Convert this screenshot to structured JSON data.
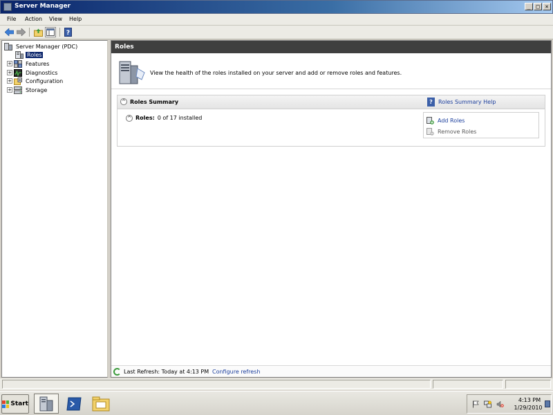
{
  "window": {
    "title": "Server Manager"
  },
  "menu": [
    "File",
    "Action",
    "View",
    "Help"
  ],
  "toolbar": {
    "icons": [
      "back-arrow-icon",
      "forward-arrow-icon",
      "up-folder-icon",
      "show-hide-tree-icon",
      "help-icon"
    ]
  },
  "tree": {
    "root": "Server Manager (PDC)",
    "items": [
      {
        "label": "Roles",
        "icon": "roles-icon",
        "selected": true,
        "expander": false
      },
      {
        "label": "Features",
        "icon": "features-icon",
        "selected": false,
        "expander": true
      },
      {
        "label": "Diagnostics",
        "icon": "diagnostics-icon",
        "selected": false,
        "expander": true
      },
      {
        "label": "Configuration",
        "icon": "configuration-icon",
        "selected": false,
        "expander": true
      },
      {
        "label": "Storage",
        "icon": "storage-icon",
        "selected": false,
        "expander": true
      }
    ]
  },
  "content": {
    "header": "Roles",
    "intro": "View the health of the roles installed on your server and add or remove roles and features.",
    "summary": {
      "title": "Roles Summary",
      "help_link": "Roles Summary Help",
      "roles_label": "Roles:",
      "roles_value": "0 of 17 installed",
      "tasks": {
        "add": "Add Roles",
        "remove": "Remove Roles"
      }
    },
    "refresh": {
      "text": "Last Refresh: Today at 4:13 PM",
      "link": "Configure refresh"
    }
  },
  "taskbar": {
    "start": "Start",
    "apps": [
      "server-manager-icon",
      "powershell-icon",
      "explorer-icon"
    ],
    "clock": {
      "time": "4:13 PM",
      "date": "1/29/2010"
    }
  },
  "colors": {
    "title_bar": "#0a246a",
    "content_header": "#3f3f3f",
    "link": "#1a3d9c",
    "selection": "#0a246a"
  }
}
